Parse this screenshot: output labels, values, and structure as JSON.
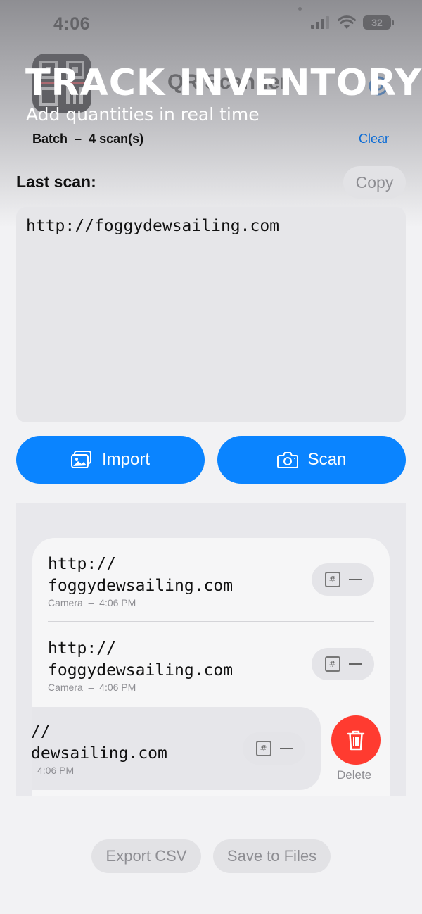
{
  "status_bar": {
    "time": "4:06",
    "battery": "32"
  },
  "app": {
    "name": "QR Scanner"
  },
  "promo": {
    "title": "TRACK INVENTORY",
    "subtitle": "Add quantities in real time"
  },
  "batch": {
    "label": "Batch",
    "count_text": "4 scan(s)",
    "clear_label": "Clear"
  },
  "last_scan": {
    "label": "Last scan:",
    "copy_label": "Copy",
    "value": "http://foggydewsailing.com"
  },
  "actions": {
    "import_label": "Import",
    "scan_label": "Scan"
  },
  "scans": [
    {
      "line1": "http://",
      "line2": "foggydewsailing.com",
      "source": "Camera",
      "time": "4:06 PM"
    },
    {
      "line1": "http://",
      "line2": "foggydewsailing.com",
      "source": "Camera",
      "time": "4:06 PM"
    },
    {
      "line1": "//",
      "line2": "dewsailing.com",
      "time": "4:06 PM"
    }
  ],
  "row_actions": {
    "delete_label": "Delete"
  },
  "footer": {
    "export_label": "Export CSV",
    "save_label": "Save to Files"
  },
  "colors": {
    "accent": "#0a84ff",
    "delete": "#ff3b30",
    "link": "#0a6bd6"
  }
}
